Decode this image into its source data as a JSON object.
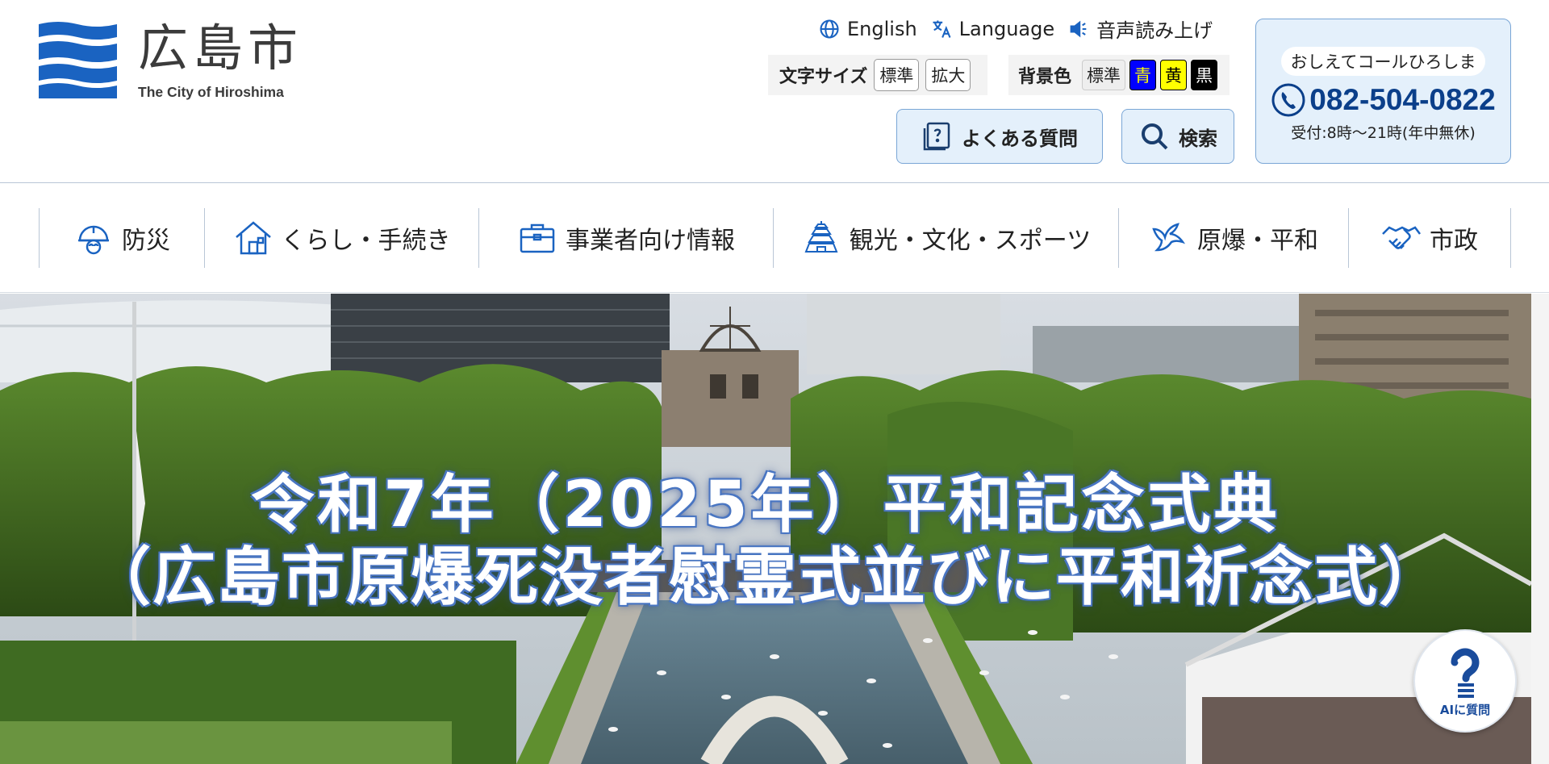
{
  "logo": {
    "name_ja": "広島市",
    "name_en": "The City of Hiroshima"
  },
  "util": {
    "english": "English",
    "language": "Language",
    "read_aloud": "音声読み上げ"
  },
  "font_size": {
    "label": "文字サイズ",
    "standard": "標準",
    "large": "拡大"
  },
  "bg_color": {
    "label": "背景色",
    "standard": "標準",
    "blue": "青",
    "yellow": "黄",
    "black": "黒"
  },
  "buttons": {
    "faq": "よくある質問",
    "search": "検索"
  },
  "call_center": {
    "name": "おしえてコールひろしま",
    "phone": "082-504-0822",
    "hours": "受付:8時～21時(年中無休)"
  },
  "nav": {
    "items": [
      {
        "label": "防災",
        "icon": "helmet-icon"
      },
      {
        "label": "くらし・手続き",
        "icon": "house-icon"
      },
      {
        "label": "事業者向け情報",
        "icon": "briefcase-icon"
      },
      {
        "label": "観光・文化・スポーツ",
        "icon": "castle-icon"
      },
      {
        "label": "原爆・平和",
        "icon": "dove-icon"
      },
      {
        "label": "市政",
        "icon": "handshake-icon"
      }
    ]
  },
  "hero": {
    "line1": "令和7年（2025年）平和記念式典",
    "line2": "（広島市原爆死没者慰霊式並びに平和祈念式）"
  },
  "ai_button": {
    "label": "AIに質問"
  },
  "colors": {
    "brand_blue": "#1a63c1",
    "accent_light": "#e4f0fb",
    "border": "#7aa6d6"
  }
}
